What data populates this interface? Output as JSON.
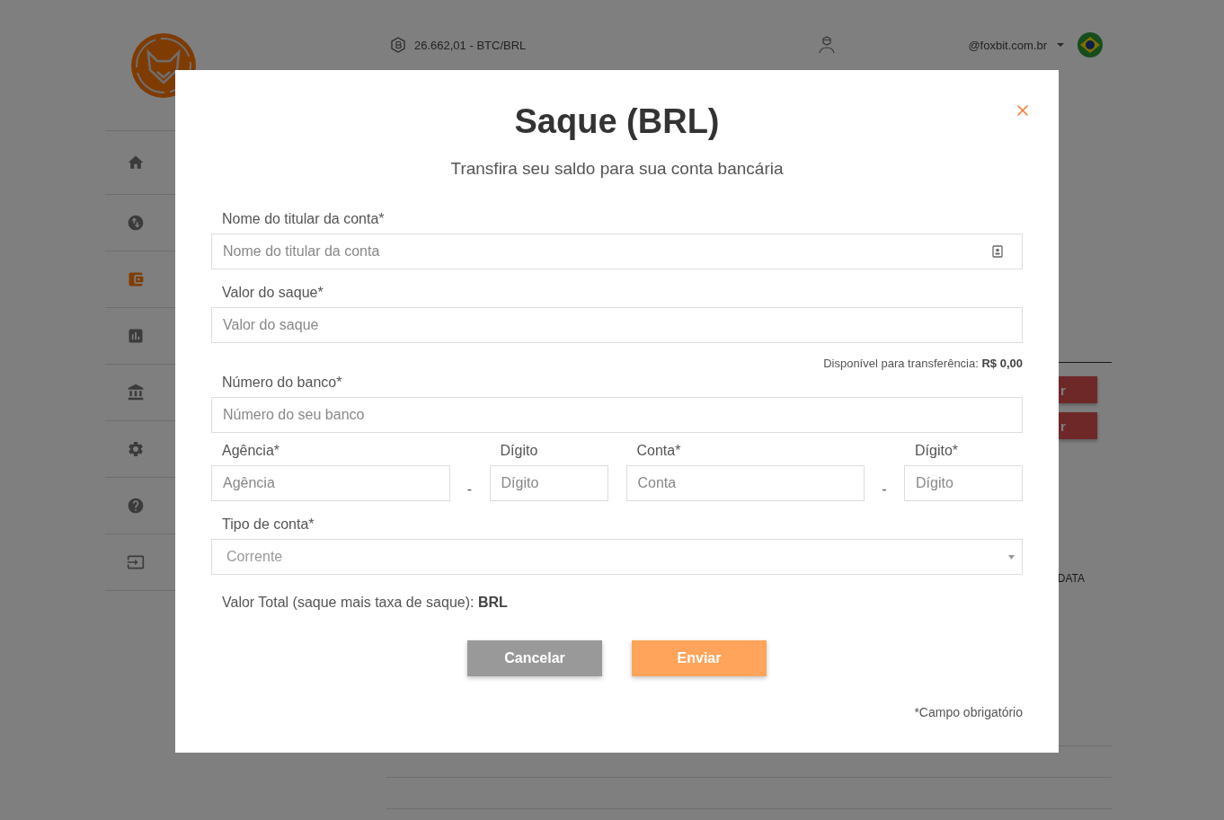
{
  "header": {
    "price": "26.662,01 - BTC/BRL",
    "account": "@foxbit.com.br"
  },
  "sidebar": {
    "items": [
      {
        "kind": "home",
        "selected": false
      },
      {
        "kind": "exchange",
        "selected": false
      },
      {
        "kind": "wallet",
        "selected": true
      },
      {
        "kind": "report",
        "selected": false
      },
      {
        "kind": "bank",
        "selected": false
      },
      {
        "kind": "settings",
        "selected": false
      },
      {
        "kind": "help",
        "selected": false
      },
      {
        "kind": "logout",
        "selected": false
      }
    ]
  },
  "background": {
    "buttons": [
      "r",
      "r"
    ],
    "column_label": "DATA"
  },
  "modal": {
    "title": "Saque (BRL)",
    "subtitle": "Transfira seu saldo para sua conta bancária",
    "fields": [
      {
        "label": "Nome do titular da conta*",
        "placeholder": "Nome do titular da conta",
        "kind": "contact"
      },
      {
        "label": "Valor do saque*",
        "placeholder": "Valor do saque",
        "kind": "plain"
      }
    ],
    "available": "Disponível para transferência: **R$ 0,00**",
    "bank": {
      "label": "Número do banco*",
      "placeholder": "Número do seu banco"
    },
    "account_groups": [
      {
        "main": {
          "label": "Agência*",
          "placeholder": "Agência"
        },
        "separator": "-",
        "check": {
          "label": "Dígito",
          "placeholder": "Dígito"
        }
      },
      {
        "main": {
          "label": "Conta*",
          "placeholder": "Conta"
        },
        "separator": "-",
        "check": {
          "label": "Dígito*",
          "placeholder": "Dígito"
        }
      }
    ],
    "account_type": {
      "label": "Tipo de conta*",
      "value": "Corrente"
    },
    "total": "Valor Total (saque mais taxa de saque):  **BRL**",
    "buttons": [
      {
        "label": "Cancelar",
        "kind": "secondary"
      },
      {
        "label": "Enviar",
        "kind": "primary"
      }
    ],
    "footnote": "*Campo obrigatório"
  }
}
